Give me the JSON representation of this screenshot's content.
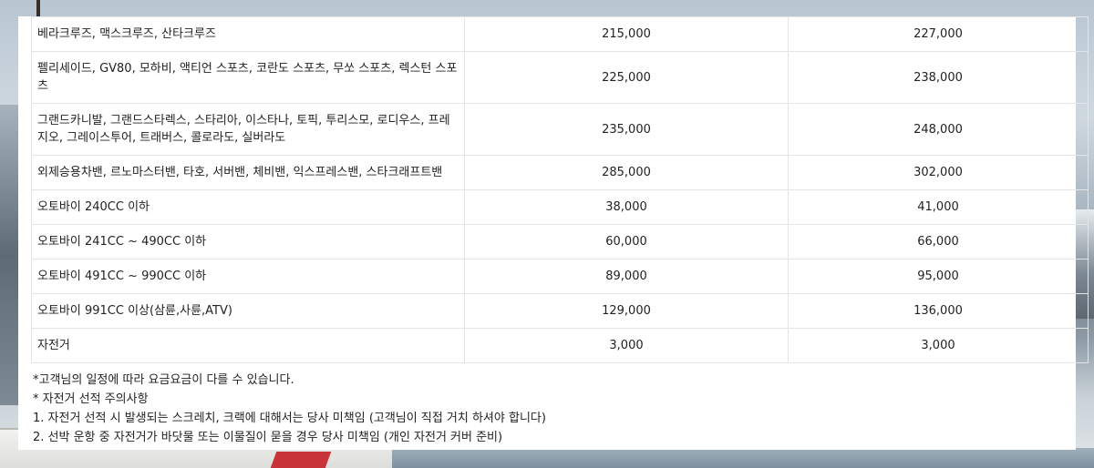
{
  "table": {
    "rows": [
      {
        "name": "베라크루즈, 맥스크루즈, 산타크루즈",
        "price1": "215,000",
        "price2": "227,000",
        "tall": false
      },
      {
        "name": "펠리세이드, GV80, 모하비, 액티언 스포츠, 코란도 스포츠, 무쏘 스포츠, 렉스턴 스포츠",
        "price1": "225,000",
        "price2": "238,000",
        "tall": true
      },
      {
        "name": "그랜드카니발, 그랜드스타렉스, 스타리아, 이스타나, 토픽, 투리스모, 로디우스, 프레지오, 그레이스투어, 트래버스, 콜로라도, 실버라도",
        "price1": "235,000",
        "price2": "248,000",
        "tall": true
      },
      {
        "name": "외제승용차밴, 르노마스터밴, 타호, 서버밴, 체비밴, 익스프레스밴, 스타크래프트밴",
        "price1": "285,000",
        "price2": "302,000",
        "tall": false
      },
      {
        "name": "오토바이 240CC 이하",
        "price1": "38,000",
        "price2": "41,000",
        "tall": false
      },
      {
        "name": "오토바이 241CC ~ 490CC 이하",
        "price1": "60,000",
        "price2": "66,000",
        "tall": false
      },
      {
        "name": "오토바이 491CC ~ 990CC 이하",
        "price1": "89,000",
        "price2": "95,000",
        "tall": false
      },
      {
        "name": "오토바이 991CC 이상(삼륜,사륜,ATV)",
        "price1": "129,000",
        "price2": "136,000",
        "tall": false
      },
      {
        "name": "자전거",
        "price1": "3,000",
        "price2": "3,000",
        "tall": false
      }
    ]
  },
  "notes": [
    "*고객님의 일정에 따라 요금요금이 다를 수 있습니다.",
    "* 자전거 선적 주의사항",
    "1. 자전거 선적 시 발생되는 스크레치, 크랙에 대해서는 당사 미책임 (고객님이 직접 거치 하셔야 합니다)",
    "2. 선박 운항 중 자전거가 바닷물 또는 이물질이 묻을 경우 당사 미책임 (개인 자전거 커버 준비)"
  ]
}
